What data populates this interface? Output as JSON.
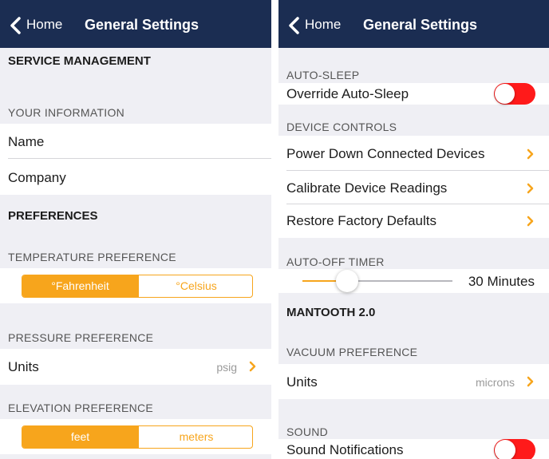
{
  "colors": {
    "nav": "#1b2d52",
    "accent": "#f7a51c",
    "toggle_on": "#ff1a1a"
  },
  "left": {
    "nav": {
      "back_label": "Home",
      "title": "General Settings"
    },
    "service_management": "SERVICE MANAGEMENT",
    "your_information": "YOUR INFORMATION",
    "name_label": "Name",
    "company_label": "Company",
    "preferences": "PREFERENCES",
    "temperature_header": "TEMPERATURE PREFERENCE",
    "temperature_options": [
      "°Fahrenheit",
      "°Celsius"
    ],
    "temperature_selected": "°Fahrenheit",
    "pressure_header": "PRESSURE PREFERENCE",
    "pressure_units_label": "Units",
    "pressure_units_value": "psig",
    "elevation_header": "ELEVATION PREFERENCE",
    "elevation_options": [
      "feet",
      "meters"
    ],
    "elevation_selected": "feet"
  },
  "right": {
    "nav": {
      "back_label": "Home",
      "title": "General Settings"
    },
    "auto_sleep_header": "AUTO-SLEEP",
    "override_auto_sleep_label": "Override Auto-Sleep",
    "override_auto_sleep_on": true,
    "device_controls_header": "DEVICE CONTROLS",
    "power_down_label": "Power Down Connected Devices",
    "calibrate_label": "Calibrate Device Readings",
    "restore_label": "Restore Factory Defaults",
    "auto_off_header": "AUTO-OFF TIMER",
    "auto_off_value": "30 Minutes",
    "auto_off_slider_fraction": 0.3,
    "mantooth_header": "MANTOOTH 2.0",
    "vacuum_header": "VACUUM PREFERENCE",
    "vacuum_units_label": "Units",
    "vacuum_units_value": "microns",
    "sound_header": "SOUND",
    "sound_notifications_label": "Sound Notifications",
    "sound_notifications_on": true
  }
}
